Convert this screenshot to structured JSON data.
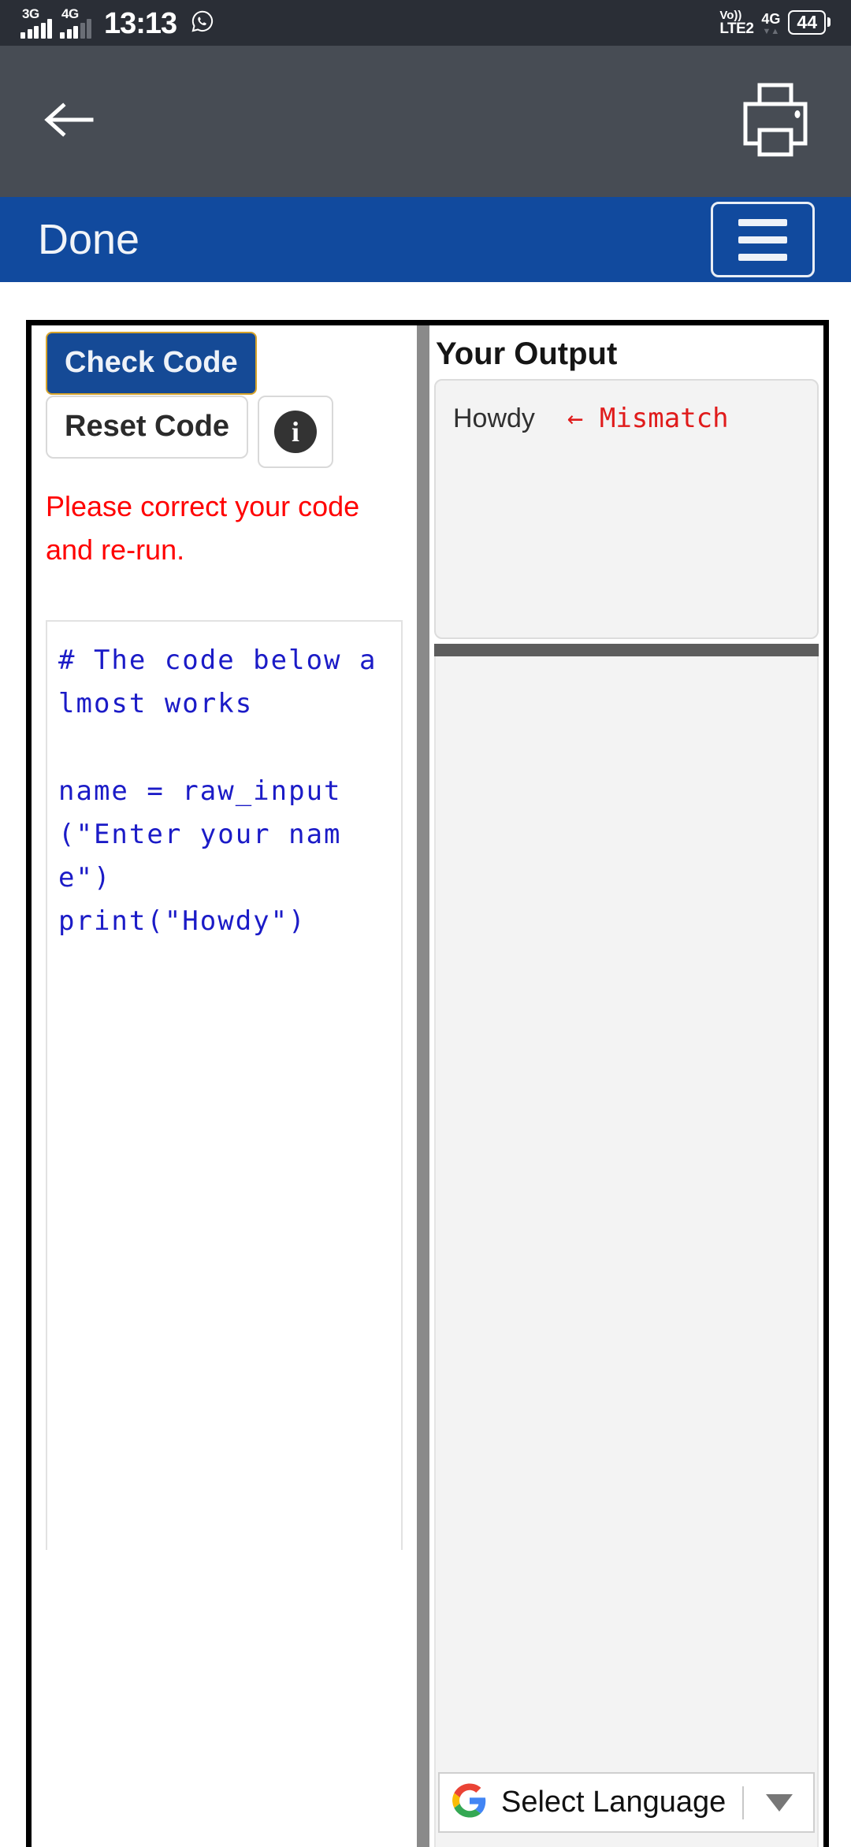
{
  "status_bar": {
    "network_1": "3G",
    "network_2": "4G",
    "time": "13:13",
    "messaging_icon": "whatsapp-icon",
    "volte_top": "Vo))",
    "volte_bottom": "LTE2",
    "network_right": "4G",
    "network_right_sub": "2",
    "battery_level": "44"
  },
  "app_toolbar": {
    "back_icon": "back-arrow-icon",
    "print_icon": "printer-icon"
  },
  "blue_bar": {
    "title": "Done",
    "menu_icon": "hamburger-menu-icon"
  },
  "left_pane": {
    "check_code_label": "Check Code",
    "reset_code_label": "Reset Code",
    "info_icon": "info-icon",
    "info_glyph": "i",
    "error_message": "Please correct your code and re-run.",
    "code": "# The code below almost works\n\nname = raw_input(\"Enter your name\")\nprint(\"Howdy\")"
  },
  "right_pane": {
    "output_title": "Your Output",
    "output_value": "Howdy",
    "output_annotation": "← Mismatch",
    "language_widget": {
      "logo": "google-logo-icon",
      "label": "Select Language",
      "caret_icon": "chevron-down-icon"
    }
  },
  "colors": {
    "status_bar_bg": "#2a2e36",
    "toolbar_bg": "#474c54",
    "blue_bar_bg": "#114a9e",
    "check_button_bg": "#154a96",
    "check_button_border": "#d6a32a",
    "error_text": "#ff0000",
    "code_text": "#1b1bc7",
    "mismatch_text": "#e01b1b",
    "splitter": "#8a8a8a"
  }
}
